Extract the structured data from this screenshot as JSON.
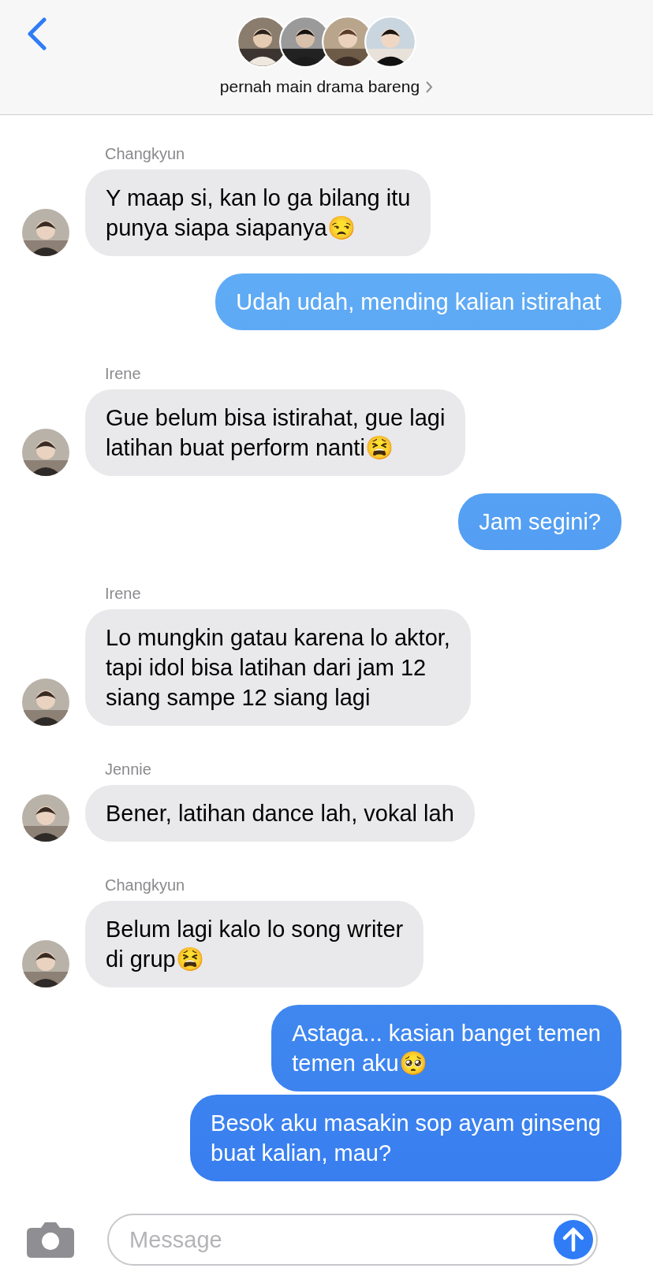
{
  "header": {
    "title": "pernah main drama bareng"
  },
  "messages": [
    {
      "kind": "received",
      "sender": "Changkyun",
      "text": "Y maap si, kan lo ga bilang itu\npunya siapa siapanya😒"
    },
    {
      "kind": "sent",
      "text": "Udah udah, mending kalian istirahat"
    },
    {
      "kind": "received",
      "sender": "Irene",
      "text": "Gue belum bisa istirahat, gue lagi\nlatihan buat perform nanti😫"
    },
    {
      "kind": "sent",
      "text": "Jam segini?"
    },
    {
      "kind": "received",
      "sender": "Irene",
      "text": "Lo mungkin gatau karena lo aktor,\ntapi idol bisa latihan dari jam 12\nsiang sampe 12 siang lagi"
    },
    {
      "kind": "received",
      "sender": "Jennie",
      "text": "Bener, latihan dance lah, vokal lah"
    },
    {
      "kind": "received",
      "sender": "Changkyun",
      "text": "Belum lagi kalo lo song writer\ndi grup😫"
    },
    {
      "kind": "sent",
      "text": "Astaga... kasian banget temen\ntemen aku🥺"
    },
    {
      "kind": "sent",
      "text": "Besok aku masakin sop ayam ginseng\nbuat kalian, mau?"
    }
  ],
  "composer": {
    "placeholder": "Message"
  }
}
